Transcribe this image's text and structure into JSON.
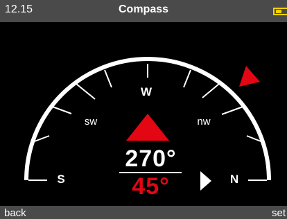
{
  "status_bar": {
    "time": "12.15",
    "title": "Compass",
    "battery_color": "#ffd200"
  },
  "compass": {
    "heading": "270°",
    "offset": "45°",
    "labels": {
      "south": "S",
      "southwest": "sw",
      "west": "W",
      "northwest": "nw",
      "north": "N"
    },
    "arc_color": "#ffffff",
    "pointer_color": "#e30613"
  },
  "softkeys": {
    "left": "back",
    "right": "set"
  }
}
